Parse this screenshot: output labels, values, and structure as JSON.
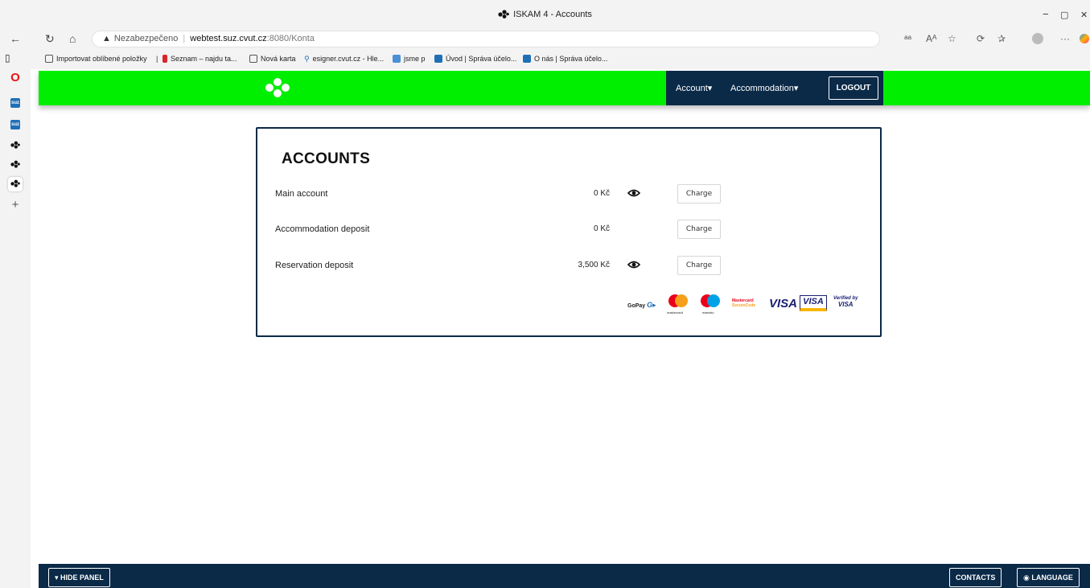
{
  "window": {
    "title": "ISKAM 4 - Accounts",
    "minimize": "−",
    "maximize": "▢",
    "close": "✕"
  },
  "browser": {
    "security_label": "Nezabezpečeno",
    "url_host": "webtest.suz.cvut.cz",
    "url_path": ":8080/Konta",
    "bookmarks": [
      {
        "label": "Importovat oblíbené položky",
        "color": "#555555"
      },
      {
        "label": "Seznam – najdu ta...",
        "color": "#d8262b"
      },
      {
        "label": "Nová karta",
        "color": "#555555"
      },
      {
        "label": "esigner.cvut.cz - Hle...",
        "color": "#1f6fb7"
      },
      {
        "label": "jsme p",
        "color": "#4b8fd6"
      },
      {
        "label": "Úvod | Správa účelo...",
        "color": "#1f6fb7"
      },
      {
        "label": "O nás | Správa účelo...",
        "color": "#1f6fb7"
      }
    ]
  },
  "nav": {
    "account": "Account▾",
    "accommodation": "Accommodation▾",
    "logout": "LOGOUT"
  },
  "accounts": {
    "title": "ACCOUNTS",
    "charge_label": "Charge",
    "rows": [
      {
        "label": "Main account",
        "amount": "0 Kč",
        "has_eye": true
      },
      {
        "label": "Accommodation deposit",
        "amount": "0 Kč",
        "has_eye": false
      },
      {
        "label": "Reservation deposit",
        "amount": "3,500 Kč",
        "has_eye": true
      }
    ]
  },
  "payment_logos": {
    "gopay": "GoPay",
    "gopay_g": "G▸",
    "mastercard": "mastercard",
    "maestro": "maestro",
    "securecode_1": "Mastercard",
    "securecode_2": "SecureCode",
    "visa": "VISA",
    "visa_electron": "VISA",
    "verified_1": "Verified by",
    "verified_2": "VISA"
  },
  "footer": {
    "hide_panel": "▾ HIDE PANEL",
    "contacts": "CONTACTS",
    "language": "LANGUAGE"
  },
  "colors": {
    "header_green": "#00ee00",
    "navy": "#0a2a48"
  }
}
